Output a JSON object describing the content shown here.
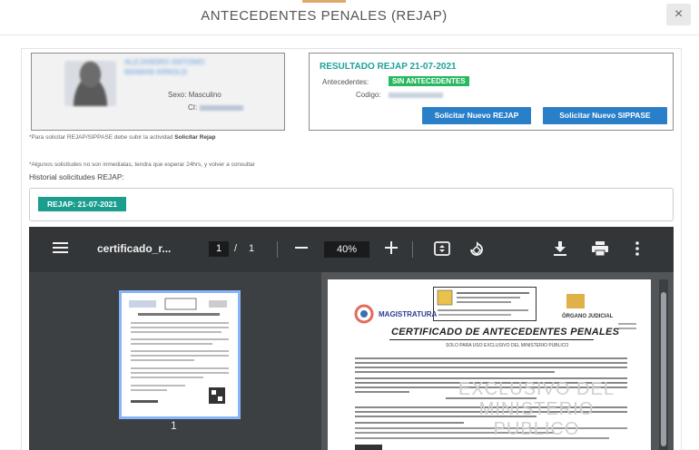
{
  "modal": {
    "title": "ANTECEDENTES PENALES (REJAP)",
    "close_label": "×"
  },
  "user_card": {
    "name_line1": "ALEJANDRO ANTONIO",
    "name_line2": "MAMANI ARNOLD",
    "sexo_label": "Sexo:",
    "sexo_value": "Masculino",
    "ci_label": "CI:"
  },
  "result_card": {
    "title": "RESULTADO REJAP 21-07-2021",
    "antecedentes_label": "Antecedentes:",
    "antecedentes_value": "SIN ANTECEDENTES",
    "codigo_label": "Codigo:",
    "btn_rejap": "Solicitar Nuevo REJAP",
    "btn_sippase": "Solicitar Nuevo SIPPASE"
  },
  "notes": {
    "note1_prefix": "*Para solicitar REJAP/SIPPASE debe subir la actividad",
    "note1_bold": "Solicitar Rejap",
    "note2": "*Algunos solicitudes no son inmediatas, tendra que esperar 24hrs, y volver a consultar"
  },
  "history": {
    "label": "Historial solicitudes REJAP:",
    "items": [
      {
        "label": "REJAP:  21-07-2021"
      }
    ]
  },
  "pdf_viewer": {
    "filename": "certificado_r...",
    "current_page": "1",
    "page_separator": "/",
    "total_pages": "1",
    "zoom": "40%",
    "thumbnail_number": "1",
    "icons": [
      "menu-icon",
      "zoom-out-icon",
      "zoom-in-icon",
      "fit-page-icon",
      "rotate-icon",
      "download-icon",
      "print-icon",
      "more-icon"
    ]
  },
  "document": {
    "title": "CERTIFICADO DE ANTECEDENTES PENALES",
    "subtitle": "SOLO PARA USO EXCLUSIVO DEL MINISTERIO PUBLICO",
    "magistratura": "MAGISTRATURA",
    "organo": "ÓRGANO JUDICIAL",
    "watermark": "EXCLUSIVO DEL MINISTERIO PUBLICO"
  },
  "colors": {
    "accent_teal": "#1aa39a",
    "badge_green": "#28b85f",
    "button_blue": "#2a7fc9",
    "pdf_toolbar": "#323639"
  }
}
